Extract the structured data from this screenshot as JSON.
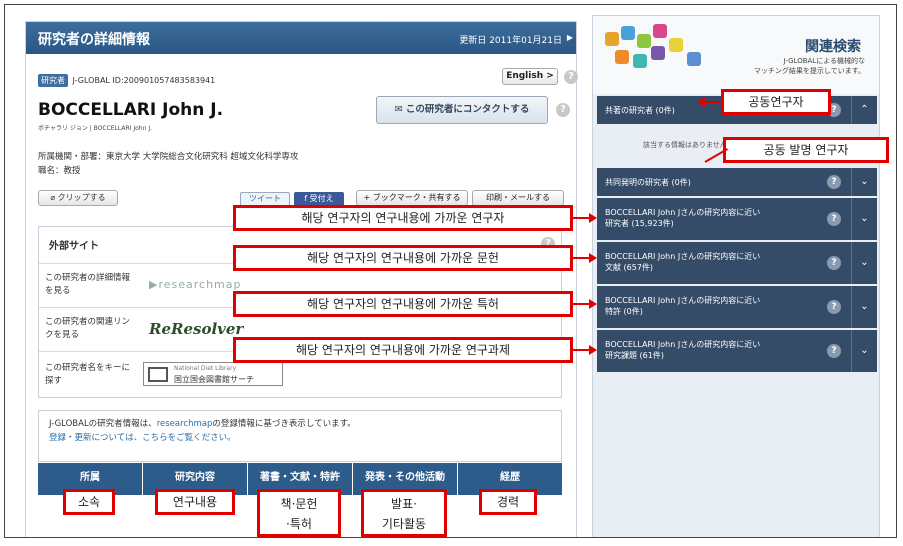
{
  "main": {
    "title": "研究者の詳細情報",
    "updated": "更新日 2011年01月21日",
    "collapse": "▶",
    "id_badge": "研究者",
    "id_text": "J-GLOBAL ID:200901057483583941",
    "english_label": "English",
    "english_arrow": ">",
    "name": "BOCCELLARI John J.",
    "kana": "ボチャラリ ジョン | BOCCELLARI John J.",
    "contact_label": "この研究者にコンタクトする",
    "affiliation": "所属機関・部署：東京大学 大学院総合文化研究科 超域文化科学専攻",
    "position": "職名：教授",
    "clip_label": "クリップする",
    "tweet_label": "ツイート",
    "like_label": "f 受付え",
    "bookmark_label": "+ ブックマーク・共有する",
    "print_label": "印刷・メールする",
    "external": {
      "title": "外部サイト",
      "rows": [
        {
          "label": "この研究者の詳細情報を見る",
          "logo": "▶researchmap"
        },
        {
          "label": "この研究者の関連リンクを見る",
          "logo": "ReResolver"
        },
        {
          "label": "この研究者名をキーに探す",
          "logo_top": "National Diet Library",
          "logo_bottom": "国立国会図書館サーチ"
        }
      ]
    },
    "note_line1": "J-GLOBALの研究者情報は、",
    "note_link": "researchmap",
    "note_line1_end": "の登録情報に基づき表示しています。",
    "note_line2": "登録・更新については、こちらをご覧ください。",
    "tabs": [
      "所属",
      "研究内容",
      "著書・文献・特許",
      "発表・その他活動",
      "経歴"
    ]
  },
  "sidebar": {
    "title": "関連検索",
    "subtitle_1": "J-GLOBALによる機械的な",
    "subtitle_2": "マッチング結果を提示しています。",
    "none_text": "該当する情報はありません",
    "rows": [
      {
        "label": "共著の研究者 (0件)"
      },
      {
        "label": "共同発明の研究者 (0件)"
      },
      {
        "label_1": "BOCCELLARI John Jさんの研究内容に近い",
        "label_2": "研究者 (15,923件)"
      },
      {
        "label_1": "BOCCELLARI John Jさんの研究内容に近い",
        "label_2": "文献 (657件)"
      },
      {
        "label_1": "BOCCELLARI John Jさんの研究内容に近い",
        "label_2": "特許 (0件)"
      },
      {
        "label_1": "BOCCELLARI John Jさんの研究内容に近い",
        "label_2": "研究課題 (61件)"
      }
    ],
    "help": "?",
    "chevron": "⌄",
    "up_chevron": "⌃"
  },
  "annotations": {
    "coauthor": "공동연구자",
    "coinventor": "공동 발명 연구자",
    "near_researcher": "해당 연구자의 연구내용에 가까운 연구자",
    "near_docs": "해당 연구자의 연구내용에 가까운 문헌",
    "near_patents": "해당 연구자의 연구내용에 가까운 특허",
    "near_projects": "해당 연구자의 연구내용에 가까운 연구과제",
    "tab_affil": "소속",
    "tab_research": "연구내용",
    "tab_books_1": "책·문헌",
    "tab_books_2": "·특허",
    "tab_present_1": "발표·",
    "tab_present_2": "기타활동",
    "tab_career": "경력"
  },
  "colors": {
    "header_blue": "#2a5683",
    "sidebar_row": "#354c68",
    "annotation_red": "#e00000"
  }
}
